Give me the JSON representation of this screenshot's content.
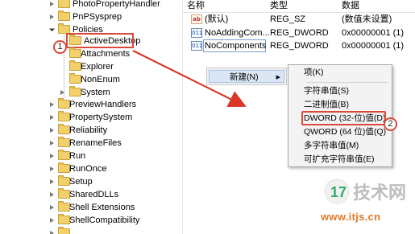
{
  "tree": {
    "items": [
      {
        "label": "PhotoPropertyHandler",
        "state": "collapsed"
      },
      {
        "label": "PnPSysprep",
        "state": "collapsed"
      },
      {
        "label": "Policies",
        "state": "expanded"
      },
      {
        "label": "ActiveDesktop",
        "state": "none",
        "selected": true
      },
      {
        "label": "Attachments",
        "state": "none"
      },
      {
        "label": "Explorer",
        "state": "none"
      },
      {
        "label": "NonEnum",
        "state": "none"
      },
      {
        "label": "System",
        "state": "collapsed"
      },
      {
        "label": "PreviewHandlers",
        "state": "collapsed"
      },
      {
        "label": "PropertySystem",
        "state": "collapsed"
      },
      {
        "label": "Reliability",
        "state": "collapsed"
      },
      {
        "label": "RenameFiles",
        "state": "collapsed"
      },
      {
        "label": "Run",
        "state": "collapsed"
      },
      {
        "label": "RunOnce",
        "state": "collapsed"
      },
      {
        "label": "Setup",
        "state": "collapsed"
      },
      {
        "label": "SharedDLLs",
        "state": "collapsed"
      },
      {
        "label": "Shell Extensions",
        "state": "collapsed"
      },
      {
        "label": "ShellCompatibility",
        "state": "collapsed"
      }
    ]
  },
  "columns": {
    "name": "名称",
    "type": "类型",
    "data": "数据"
  },
  "values": [
    {
      "icon": "string-value-icon",
      "glyph": "ab",
      "name": "(默认)",
      "type": "REG_SZ",
      "data": "(数值未设置)"
    },
    {
      "icon": "binary-value-icon",
      "glyph": "011",
      "name": "NoAddingCom...",
      "type": "REG_DWORD",
      "data": "0x00000001 (1)"
    },
    {
      "icon": "binary-value-icon",
      "glyph": "011",
      "name": "NoComponents",
      "type": "REG_DWORD",
      "data": "0x00000001 (1)"
    }
  ],
  "context_menu": {
    "new_label": "新建(N)",
    "arrow": "▶"
  },
  "submenu": {
    "items": [
      "项(K)",
      "字符串值(S)",
      "二进制值(B)",
      "DWORD (32-位)值(D)",
      "QWORD (64 位)值(Q)",
      "多字符串值(M)",
      "可扩充字符串值(E)"
    ],
    "highlighted_index": 3
  },
  "annotations": {
    "step1": "1",
    "step2": "2",
    "arrow_color": "#d9382b",
    "highlight_color": "#d94a3a"
  },
  "watermark": {
    "logo_text": "技术网",
    "url": "www.itjs.cn"
  }
}
